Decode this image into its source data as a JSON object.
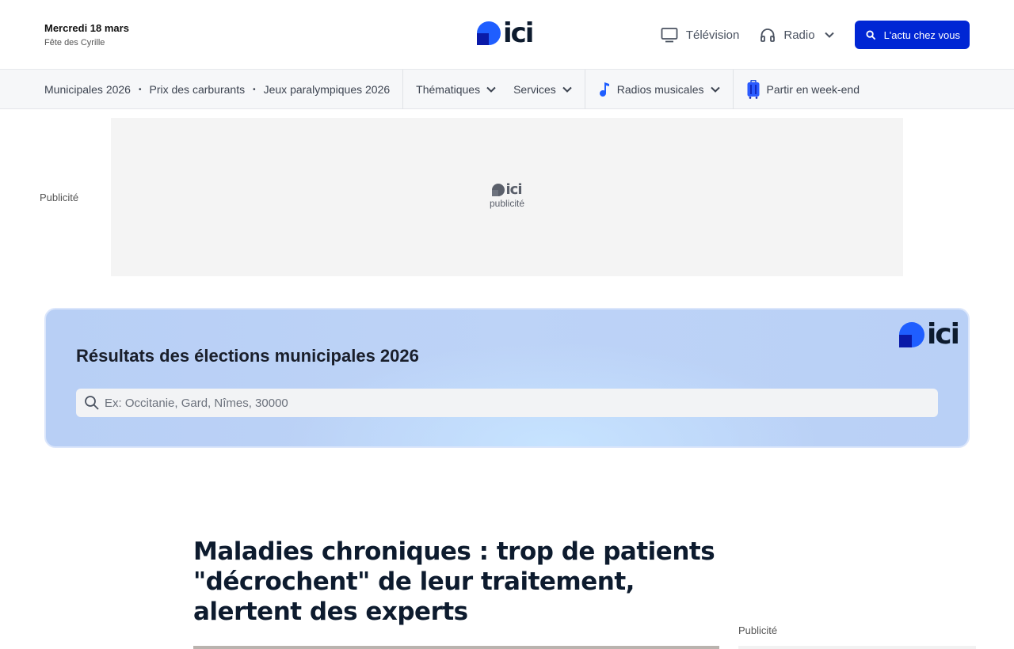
{
  "header": {
    "date": "Mercredi 18 mars",
    "fete": "Fête des Cyrille",
    "logo_text": "ici",
    "nav": [
      {
        "label": "Télévision",
        "icon": "tv-icon"
      },
      {
        "label": "Radio",
        "icon": "headphones-icon"
      }
    ],
    "actu_button": "L'actu chez vous",
    "accent_color": "#0026d4"
  },
  "subnav": {
    "links": [
      "Municipales 2026",
      "Prix des carburants",
      "Jeux paralympiques 2026"
    ],
    "bullet": "•",
    "dropdowns": [
      "Thématiques",
      "Services"
    ],
    "radios": "Radios musicales",
    "weekend": "Partir en week-end"
  },
  "ad": {
    "label": "Publicité",
    "logo_text": "ici",
    "logo_sub": "publicité"
  },
  "elections": {
    "title": "Résultats des élections municipales 2026",
    "logo_text": "ici",
    "search_placeholder": "Ex: Occitanie, Gard, Nîmes, 30000"
  },
  "article": {
    "title": "Maladies chroniques : trop de patients \"décrochent\" de leur traitement, alertent des experts"
  },
  "sidebar": {
    "pub_label": "Publicité"
  }
}
